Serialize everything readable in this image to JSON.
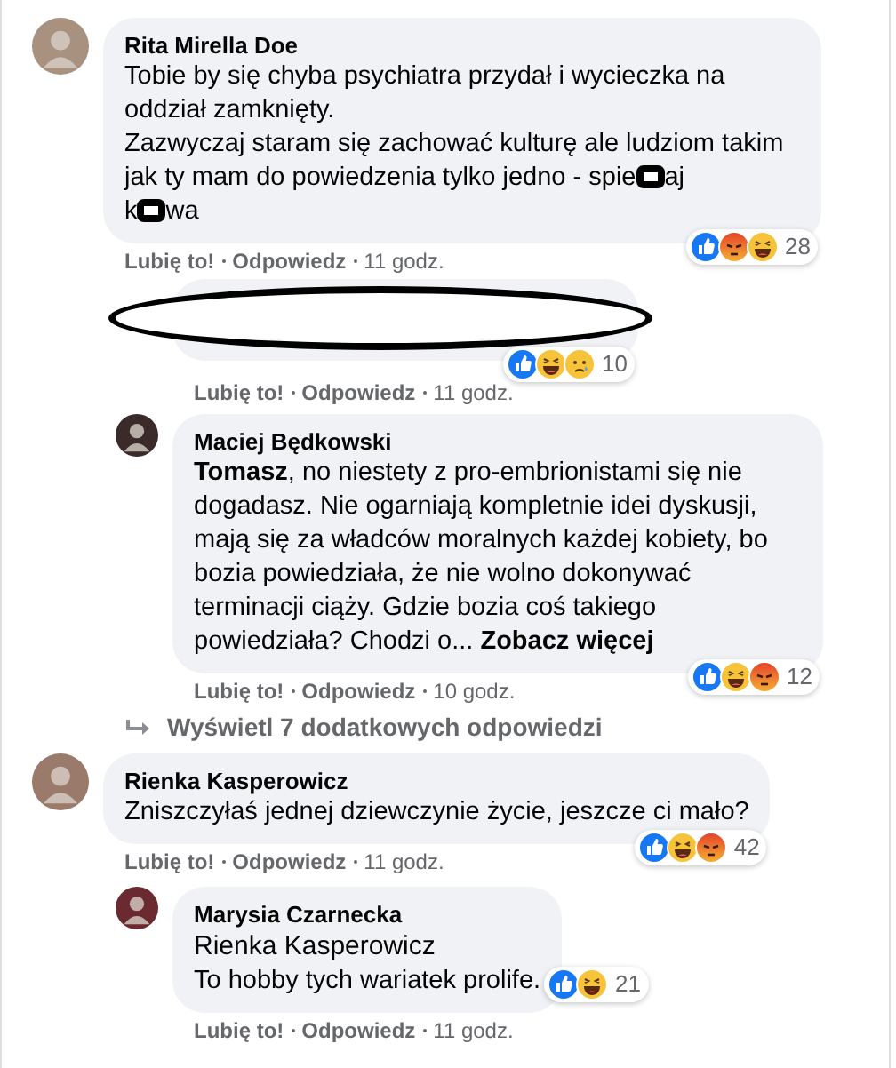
{
  "comments": [
    {
      "kind": "comment",
      "author": "Rita Mirella Doe",
      "avatar": {
        "color": "#a8917f"
      },
      "body": [
        [
          {
            "kind": "text",
            "text": "Tobie by się chyba psychiatra przydał i wycieczka na oddział zamknięty."
          }
        ],
        [
          {
            "kind": "text",
            "text": "Zazwyczaj staram się zachować kulturę ale ludziom takim jak ty mam do powiedzenia tylko jedno - spie"
          },
          {
            "kind": "redaction"
          },
          {
            "kind": "text",
            "text": "aj"
          }
        ],
        [
          {
            "kind": "text",
            "text": "k"
          },
          {
            "kind": "redaction"
          },
          {
            "kind": "text",
            "text": "wa"
          }
        ]
      ],
      "reactions": {
        "kind": "corner",
        "icons": [
          {
            "kind": "like"
          },
          {
            "kind": "angry"
          },
          {
            "kind": "haha"
          }
        ],
        "count": "28"
      },
      "actions": {
        "like": "Lubię to!",
        "reply": "Odpowiedz",
        "time": "11 godz."
      },
      "children": [
        {
          "kind": "redacted",
          "reactions": {
            "kind": "corner",
            "icons": [
              {
                "kind": "like"
              },
              {
                "kind": "haha"
              },
              {
                "kind": "sad"
              }
            ],
            "count": "10"
          },
          "actions": {
            "like": "Lubię to!",
            "reply": "Odpowiedz",
            "time": "11 godz."
          }
        },
        {
          "kind": "comment",
          "author": "Maciej Będkowski",
          "avatar": {
            "color": "#3a2a2a"
          },
          "body": [
            [
              {
                "kind": "text",
                "text": "**Tomasz**, no niestety z pro-embrionistami się nie dogadasz. Nie ogarniają kompletnie idei dyskusji, mają się za władców moralnych każdej kobiety, bo bozia powiedziała, że nie wolno dokonywać terminacji ciąży. Gdzie bozia coś takiego powiedziała? Chodzi o..."
              },
              {
                "kind": "link",
                "text": "Zobacz więcej"
              }
            ]
          ],
          "reactions": {
            "kind": "corner",
            "icons": [
              {
                "kind": "like"
              },
              {
                "kind": "haha"
              },
              {
                "kind": "angry"
              }
            ],
            "count": "12"
          },
          "actions": {
            "like": "Lubię to!",
            "reply": "Odpowiedz",
            "time": "10 godz."
          }
        }
      ],
      "more_replies": "Wyświetl 7 dodatkowych odpowiedzi"
    },
    {
      "kind": "comment",
      "author": "Rienka Kasperowicz",
      "avatar": {
        "color": "#9a7a6a"
      },
      "body": [
        [
          {
            "kind": "text",
            "text": "Zniszczyłaś jednej dziewczynie życie, jeszcze ci mało?"
          }
        ]
      ],
      "reactions": {
        "kind": "corner",
        "icons": [
          {
            "kind": "like"
          },
          {
            "kind": "haha"
          },
          {
            "kind": "angry"
          }
        ],
        "count": "42"
      },
      "actions": {
        "like": "Lubię to!",
        "reply": "Odpowiedz",
        "time": "11 godz."
      },
      "children": [
        {
          "kind": "comment",
          "author": "Marysia Czarnecka",
          "avatar": {
            "color": "#6a2a30"
          },
          "mention": "Rienka Kasperowicz",
          "body": [
            [
              {
                "kind": "text",
                "text": "To hobby tych wariatek prolife."
              }
            ]
          ],
          "reactions": {
            "kind": "inline",
            "icons": [
              {
                "kind": "like"
              },
              {
                "kind": "haha"
              }
            ],
            "count": "21"
          },
          "actions": {
            "like": "Lubię to!",
            "reply": "Odpowiedz",
            "time": "11 godz."
          }
        }
      ]
    }
  ]
}
